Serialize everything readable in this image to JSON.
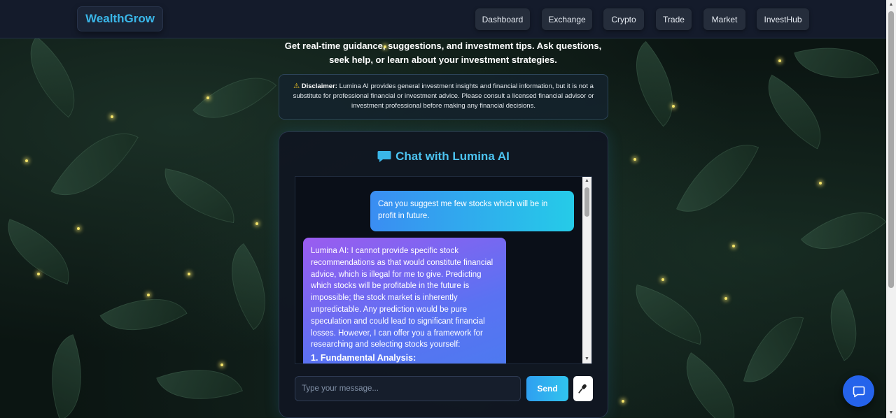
{
  "brand": {
    "name": "WealthGrow"
  },
  "nav": {
    "items": [
      {
        "label": "Dashboard"
      },
      {
        "label": "Exchange"
      },
      {
        "label": "Crypto"
      },
      {
        "label": "Trade"
      },
      {
        "label": "Market"
      },
      {
        "label": "InvestHub"
      }
    ]
  },
  "intro": {
    "text": "Get real-time guidance, suggestions, and investment tips. Ask questions, seek help, or learn about your investment strategies."
  },
  "disclaimer": {
    "icon": "warning-icon",
    "label": "Disclaimer:",
    "text": "Lumina AI provides general investment insights and financial information, but it is not a substitute for professional financial or investment advice. Please consult a licensed financial advisor or investment professional before making any financial decisions."
  },
  "chat": {
    "title": "Chat with Lumina AI",
    "title_icon": "chat-bubble-icon",
    "messages": {
      "user": "Can you suggest me few stocks which will be in profit in future.",
      "ai": "Lumina AI: I cannot provide specific stock recommendations as that would constitute financial advice, which is illegal for me to give. Predicting which stocks will be profitable in the future is impossible; the stock market is inherently unpredictable. Any prediction would be pure speculation and could lead to significant financial losses. However, I can offer you a framework for researching and selecting stocks yourself:",
      "ai_heading": "1. Fundamental Analysis:"
    },
    "input": {
      "placeholder": "Type your message...",
      "value": ""
    },
    "send_label": "Send",
    "mic_icon": "microphone-icon"
  },
  "fab": {
    "icon": "message-square-icon"
  },
  "colors": {
    "accent": "#3ab6e8",
    "send_gradient": [
      "#2f9ff0",
      "#30c4ee"
    ],
    "user_bubble": [
      "#3a8df2",
      "#25cbe8"
    ],
    "ai_bubble": [
      "#9b5cf0",
      "#4b7bf0"
    ],
    "fab": "#2563eb"
  }
}
